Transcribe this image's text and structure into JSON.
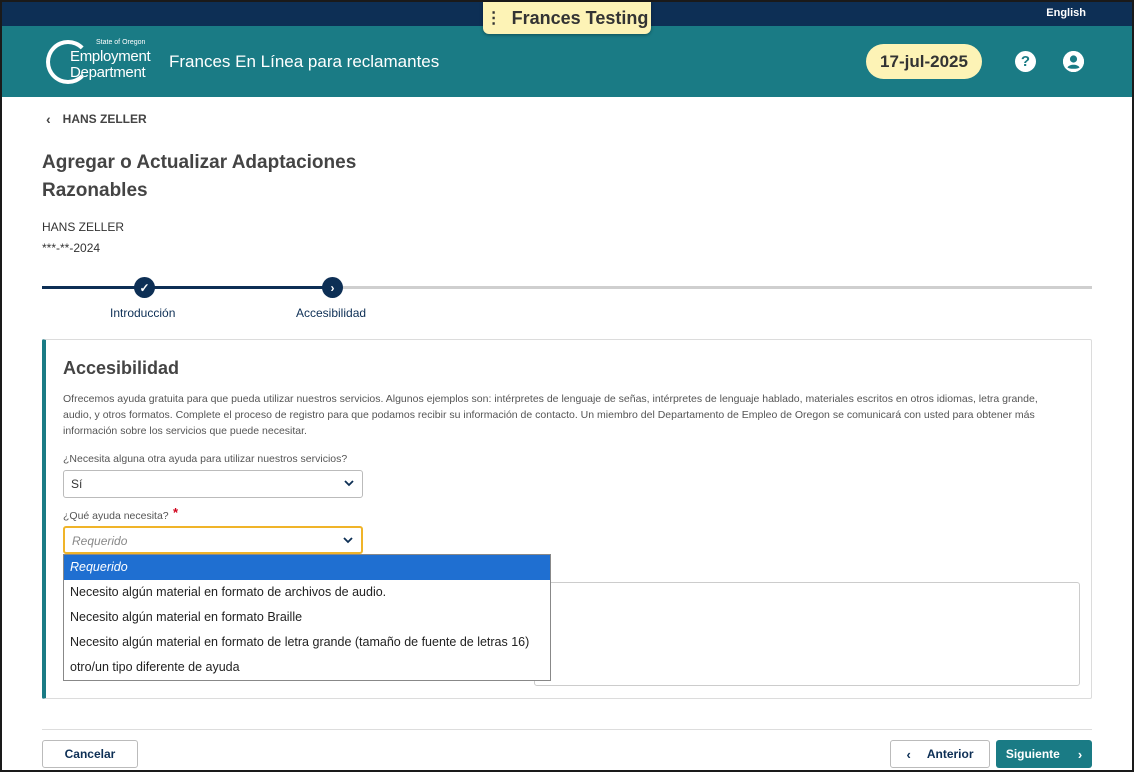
{
  "top_bar": {
    "language_link": "English"
  },
  "environment_badge": {
    "label": "Frances Testing",
    "menu_icon": "kebab-icon"
  },
  "header": {
    "logo": {
      "small_text": "State of Oregon",
      "line1": "Employment",
      "line2": "Department"
    },
    "app_title": "Frances En Línea para reclamantes",
    "date": "17-jul-2025",
    "icons": [
      "help-icon",
      "user-account-icon"
    ],
    "help_glyph": "?",
    "colors": {
      "header_bg": "#1a7b85",
      "top_bar_bg": "#0d2f55",
      "badge_bg": "#fdf3b6"
    }
  },
  "breadcrumb": {
    "back_icon": "chevron-left-icon",
    "label": "HANS ZELLER"
  },
  "page": {
    "title": "Agregar o Actualizar Adaptaciones Razonables",
    "claimant_name": "HANS ZELLER",
    "claimant_ssn": "***-**-2024"
  },
  "stepper": {
    "steps": [
      {
        "label": "Introducción",
        "status": "complete",
        "icon": "check-icon",
        "glyph": "✓"
      },
      {
        "label": "Accesibilidad",
        "status": "current",
        "icon": "chevron-right-icon",
        "glyph": "›"
      }
    ]
  },
  "section": {
    "title": "Accesibilidad",
    "description": "Ofrecemos ayuda gratuita para que pueda utilizar nuestros servicios. Algunos ejemplos son: intérpretes de lenguaje de señas, intérpretes de lenguaje hablado, materiales escritos en otros idiomas, letra grande, audio, y otros formatos. Complete el proceso de registro para que podamos recibir su información de contacto. Un miembro del Departamento de Empleo de Oregon se comunicará con usted para obtener más información sobre los servicios que puede necesitar.",
    "question1": {
      "label": "¿Necesita alguna otra ayuda para utilizar nuestros servicios?",
      "value": "Sí"
    },
    "question2": {
      "label": "¿Qué ayuda necesita?",
      "required_marker": "*",
      "placeholder": "Requerido",
      "options": [
        "Requerido",
        "Necesito algún material en formato de archivos de audio.",
        "Necesito algún material en formato Braille",
        "Necesito algún material en formato de letra grande (tamaño de fuente de letras 16)",
        "otro/un tipo diferente de ayuda"
      ],
      "highlighted_option": "Requerido"
    }
  },
  "footer": {
    "cancel": "Cancelar",
    "previous": "Anterior",
    "next": "Siguiente"
  }
}
